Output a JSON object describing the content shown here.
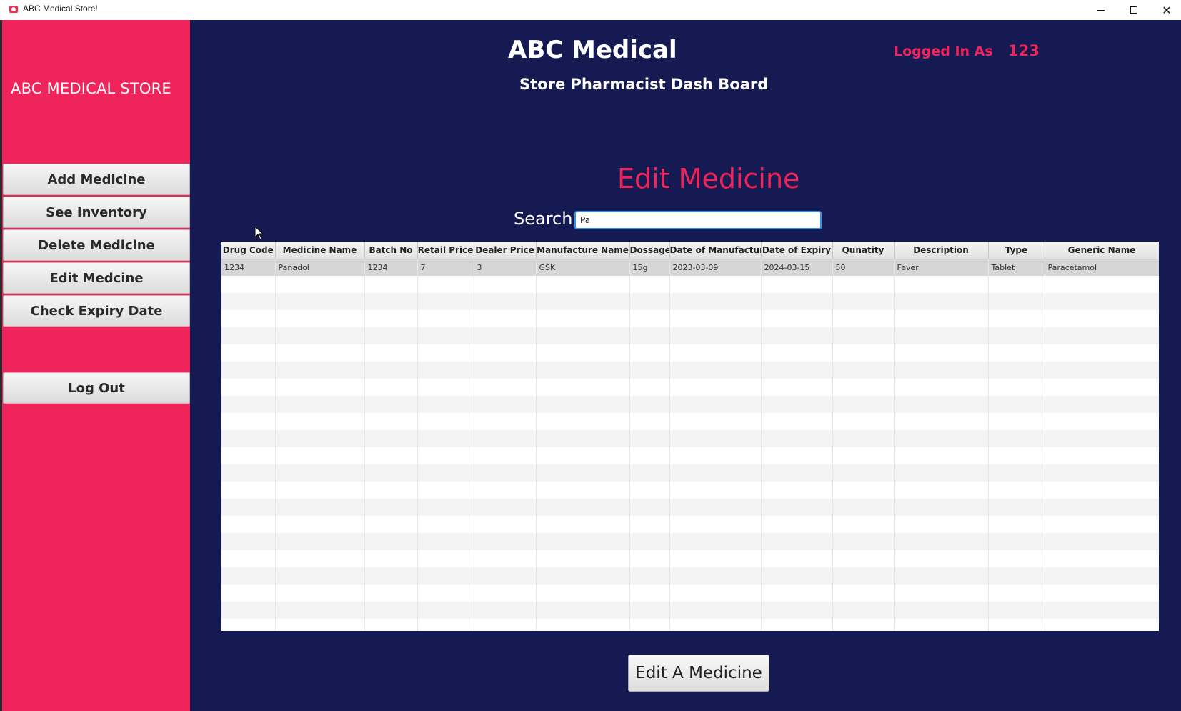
{
  "window": {
    "title": "ABC Medical Store!",
    "close_glyph": "✕"
  },
  "sidebar": {
    "store_name": "ABC MEDICAL STORE",
    "items": [
      {
        "label": "Add Medicine"
      },
      {
        "label": "See Inventory"
      },
      {
        "label": "Delete Medicine"
      },
      {
        "label": "Edit Medcine"
      },
      {
        "label": "Check Expiry Date"
      }
    ],
    "logout_label": "Log Out"
  },
  "header": {
    "brand": "ABC Medical",
    "subtitle": "Store Pharmacist Dash Board",
    "logged_in_label": "Logged In As",
    "logged_in_user": "123"
  },
  "main": {
    "section_title": "Edit Medicine",
    "search_label": "Search",
    "search_value": "Pa",
    "edit_button_label": "Edit A Medicine"
  },
  "table": {
    "columns": [
      "Drug Code",
      "Medicine Name",
      "Batch No",
      "Retail Price",
      "Dealer Price",
      "Manufacture Name",
      "Dossage",
      "Date of Manufacture",
      "Date of Expiry",
      "Qunatity",
      "Description",
      "Type",
      "Generic Name"
    ],
    "rows": [
      [
        "1234",
        "Panadol",
        "1234",
        "7",
        "3",
        "GSK",
        "15g",
        "2023-03-09",
        "2024-03-15",
        "50",
        "Fever",
        "Tablet",
        "Paracetamol"
      ]
    ]
  },
  "colors": {
    "background": "#161a52",
    "sidebar": "#ee245b",
    "accent": "#ee245b",
    "search_focus": "#3a8fe0"
  }
}
